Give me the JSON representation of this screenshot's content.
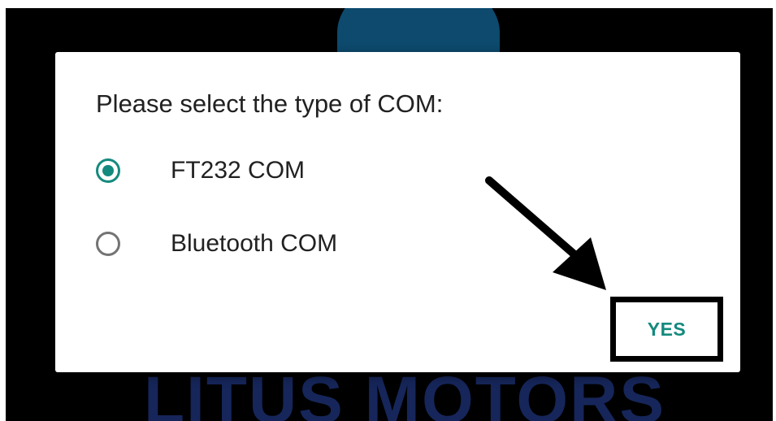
{
  "background": {
    "watermark_text": "LITUS MOTORS"
  },
  "dialog": {
    "title": "Please select the type of COM:",
    "options": [
      {
        "label": "FT232 COM",
        "selected": true
      },
      {
        "label": "Bluetooth COM",
        "selected": false
      }
    ],
    "confirm_label": "YES"
  },
  "colors": {
    "accent": "#148a7e",
    "screen_background": "#000000",
    "dialog_background": "#ffffff",
    "watermark": "#16265a"
  },
  "icons": [
    "radio-checked-icon",
    "radio-unchecked-icon",
    "arrow-pointer-icon"
  ]
}
